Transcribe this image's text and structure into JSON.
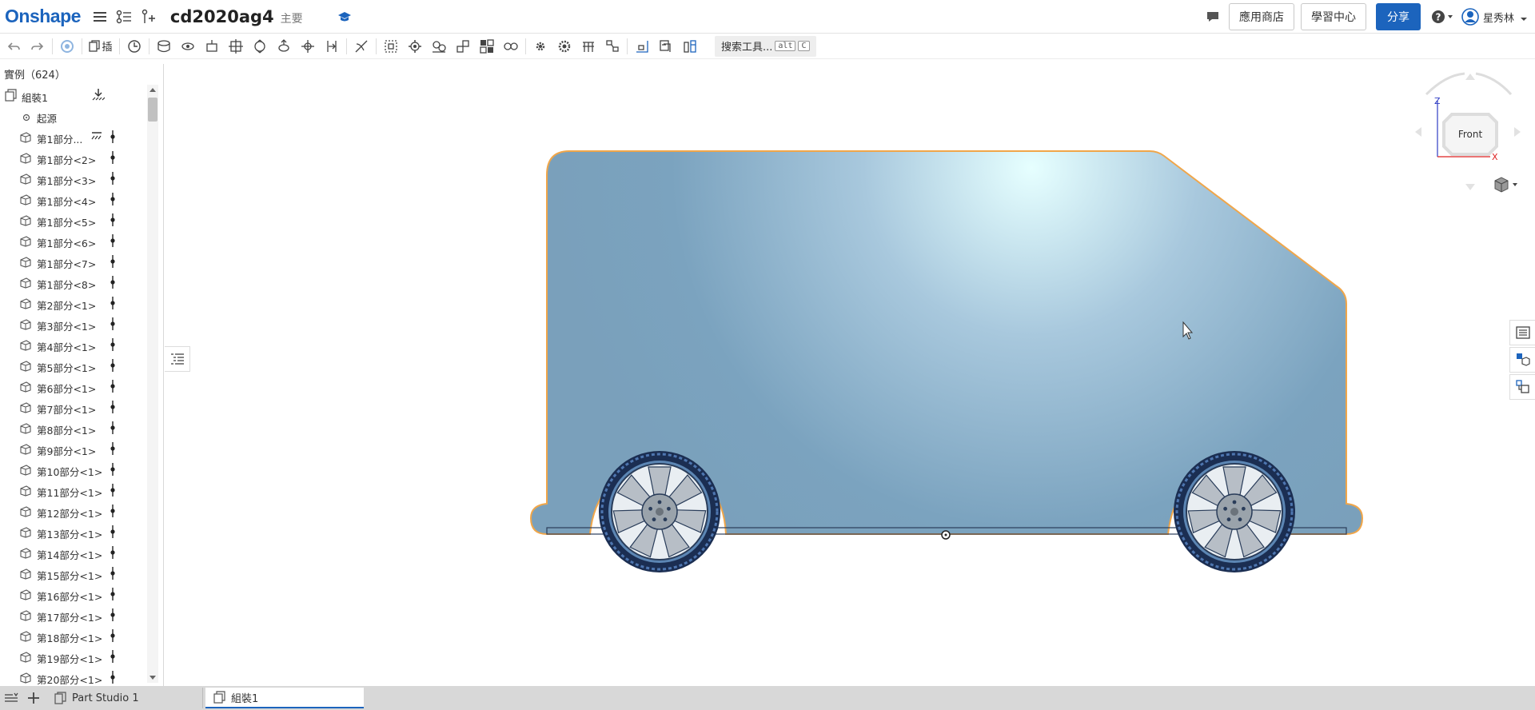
{
  "header": {
    "logo": "Onshape",
    "doc_title": "cd2020ag4",
    "branch": "主要",
    "app_store": "應用商店",
    "learning_center": "學習中心",
    "share": "分享",
    "user": "星秀林"
  },
  "toolbar": {
    "insert_label": "插",
    "search_tools": "搜索工具...",
    "kbd_alt": "alt",
    "kbd_c": "C"
  },
  "tree": {
    "header": "實例（624）",
    "root": "組裝1",
    "origin": "起源",
    "items": [
      "第1部分...",
      "第1部分<2>",
      "第1部分<3>",
      "第1部分<4>",
      "第1部分<5>",
      "第1部分<6>",
      "第1部分<7>",
      "第1部分<8>",
      "第2部分<1>",
      "第3部分<1>",
      "第4部分<1>",
      "第5部分<1>",
      "第6部分<1>",
      "第7部分<1>",
      "第8部分<1>",
      "第9部分<1>",
      "第10部分<1>",
      "第11部分<1>",
      "第12部分<1>",
      "第13部分<1>",
      "第14部分<1>",
      "第15部分<1>",
      "第16部分<1>",
      "第17部分<1>",
      "第18部分<1>",
      "第19部分<1>",
      "第20部分<1>"
    ]
  },
  "view_cube": {
    "face": "Front",
    "axis_z": "Z",
    "axis_x": "X"
  },
  "tabs": {
    "part_studio": "Part Studio 1",
    "assembly": "組裝1"
  },
  "colors": {
    "brand": "#1c64bd",
    "body_fill": "#7ba3bf",
    "body_edge": "#f0a64a",
    "highlight": "#e6ffff"
  }
}
